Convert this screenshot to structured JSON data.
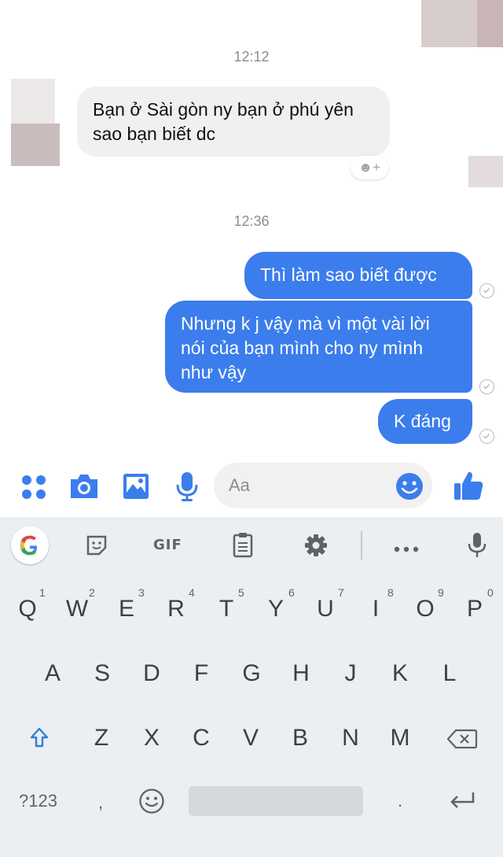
{
  "messages": {
    "time_1": "12:12",
    "incoming": "Bạn ở Sài gòn ny bạn ở phú yên sao bạn biết dc",
    "react_hint": "☻+",
    "time_2": "12:36",
    "out_1": "Thì làm sao biết được",
    "out_2": "Nhưng k j vậy mà vì một vài lời nói của bạn mình cho ny mình như vậy",
    "out_3": "K đáng"
  },
  "composer": {
    "placeholder": "Aa"
  },
  "keyboard": {
    "gif_label": "GIF",
    "row1": [
      "Q",
      "W",
      "E",
      "R",
      "T",
      "Y",
      "U",
      "I",
      "O",
      "P"
    ],
    "row1_hints": [
      "1",
      "2",
      "3",
      "4",
      "5",
      "6",
      "7",
      "8",
      "9",
      "0"
    ],
    "row2": [
      "A",
      "S",
      "D",
      "F",
      "G",
      "H",
      "J",
      "K",
      "L"
    ],
    "row3": [
      "Z",
      "X",
      "C",
      "V",
      "B",
      "N",
      "M"
    ],
    "symbols_key": "?123",
    "comma_key": ",",
    "period_key": "."
  },
  "colors": {
    "messenger_blue": "#3b7ded",
    "incoming_bubble": "#f1f0f0",
    "keyboard_bg": "#eceff1"
  },
  "icons": [
    "apps-icon",
    "camera-icon",
    "image-icon",
    "mic-icon",
    "emoji-icon",
    "thumbs-up-icon",
    "google-icon",
    "sticker-icon",
    "clipboard-icon",
    "settings-icon",
    "more-icon",
    "voice-icon",
    "shift-icon",
    "backspace-icon",
    "emoji-key-icon",
    "enter-icon"
  ]
}
